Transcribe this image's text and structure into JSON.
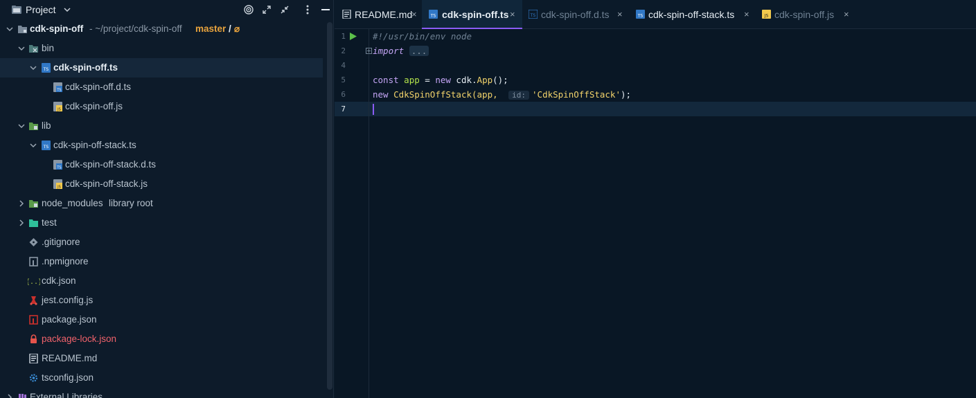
{
  "project_panel": {
    "title": "Project",
    "tree": {
      "root": {
        "name": "cdk-spin-off",
        "path": " - ~/project/cdk-spin-off",
        "branch": "master",
        "branch_sep": "/",
        "branch_status": "⌀"
      },
      "bin": "bin",
      "bin_ts": "cdk-spin-off.ts",
      "bin_dts": "cdk-spin-off.d.ts",
      "bin_js": "cdk-spin-off.js",
      "lib": "lib",
      "lib_ts": "cdk-spin-off-stack.ts",
      "lib_dts": "cdk-spin-off-stack.d.ts",
      "lib_js": "cdk-spin-off-stack.js",
      "node_modules": "node_modules",
      "node_modules_tag": "library root",
      "test": "test",
      "gitignore": ".gitignore",
      "npmignore": ".npmignore",
      "cdk_json": "cdk.json",
      "jest_config": "jest.config.js",
      "package_json": "package.json",
      "package_lock": "package-lock.json",
      "readme": "README.md",
      "tsconfig": "tsconfig.json",
      "external_libraries": "External Libraries"
    }
  },
  "tabs": [
    {
      "label": "README.md"
    },
    {
      "label": "cdk-spin-off.ts"
    },
    {
      "label": "cdk-spin-off.d.ts"
    },
    {
      "label": "cdk-spin-off-stack.ts"
    },
    {
      "label": "cdk-spin-off.js"
    }
  ],
  "tab_close": "×",
  "editor": {
    "line_numbers": [
      "1",
      "2",
      "4",
      "5",
      "6",
      "7"
    ],
    "code": {
      "shebang": "#!/usr/bin/env node",
      "import_kw": "import",
      "import_fold": "...",
      "l5_const": "const",
      "l5_var": "app",
      "l5_eq": " = ",
      "l5_new": "new",
      "l5_cdk": " cdk.",
      "l5_app": "App",
      "l5_end": "();",
      "l6_new": "new",
      "l6_cls": "CdkSpinOffStack",
      "l6_open": "(app, ",
      "l6_hint": "id:",
      "l6_str": "'CdkSpinOffStack'",
      "l6_end": ");"
    }
  },
  "colors": {
    "accent": "#8b5cf6",
    "branch": "#e8a33d",
    "error_file": "#f0626b",
    "ts_icon": "#3178c6",
    "js_icon": "#f2c94c"
  }
}
